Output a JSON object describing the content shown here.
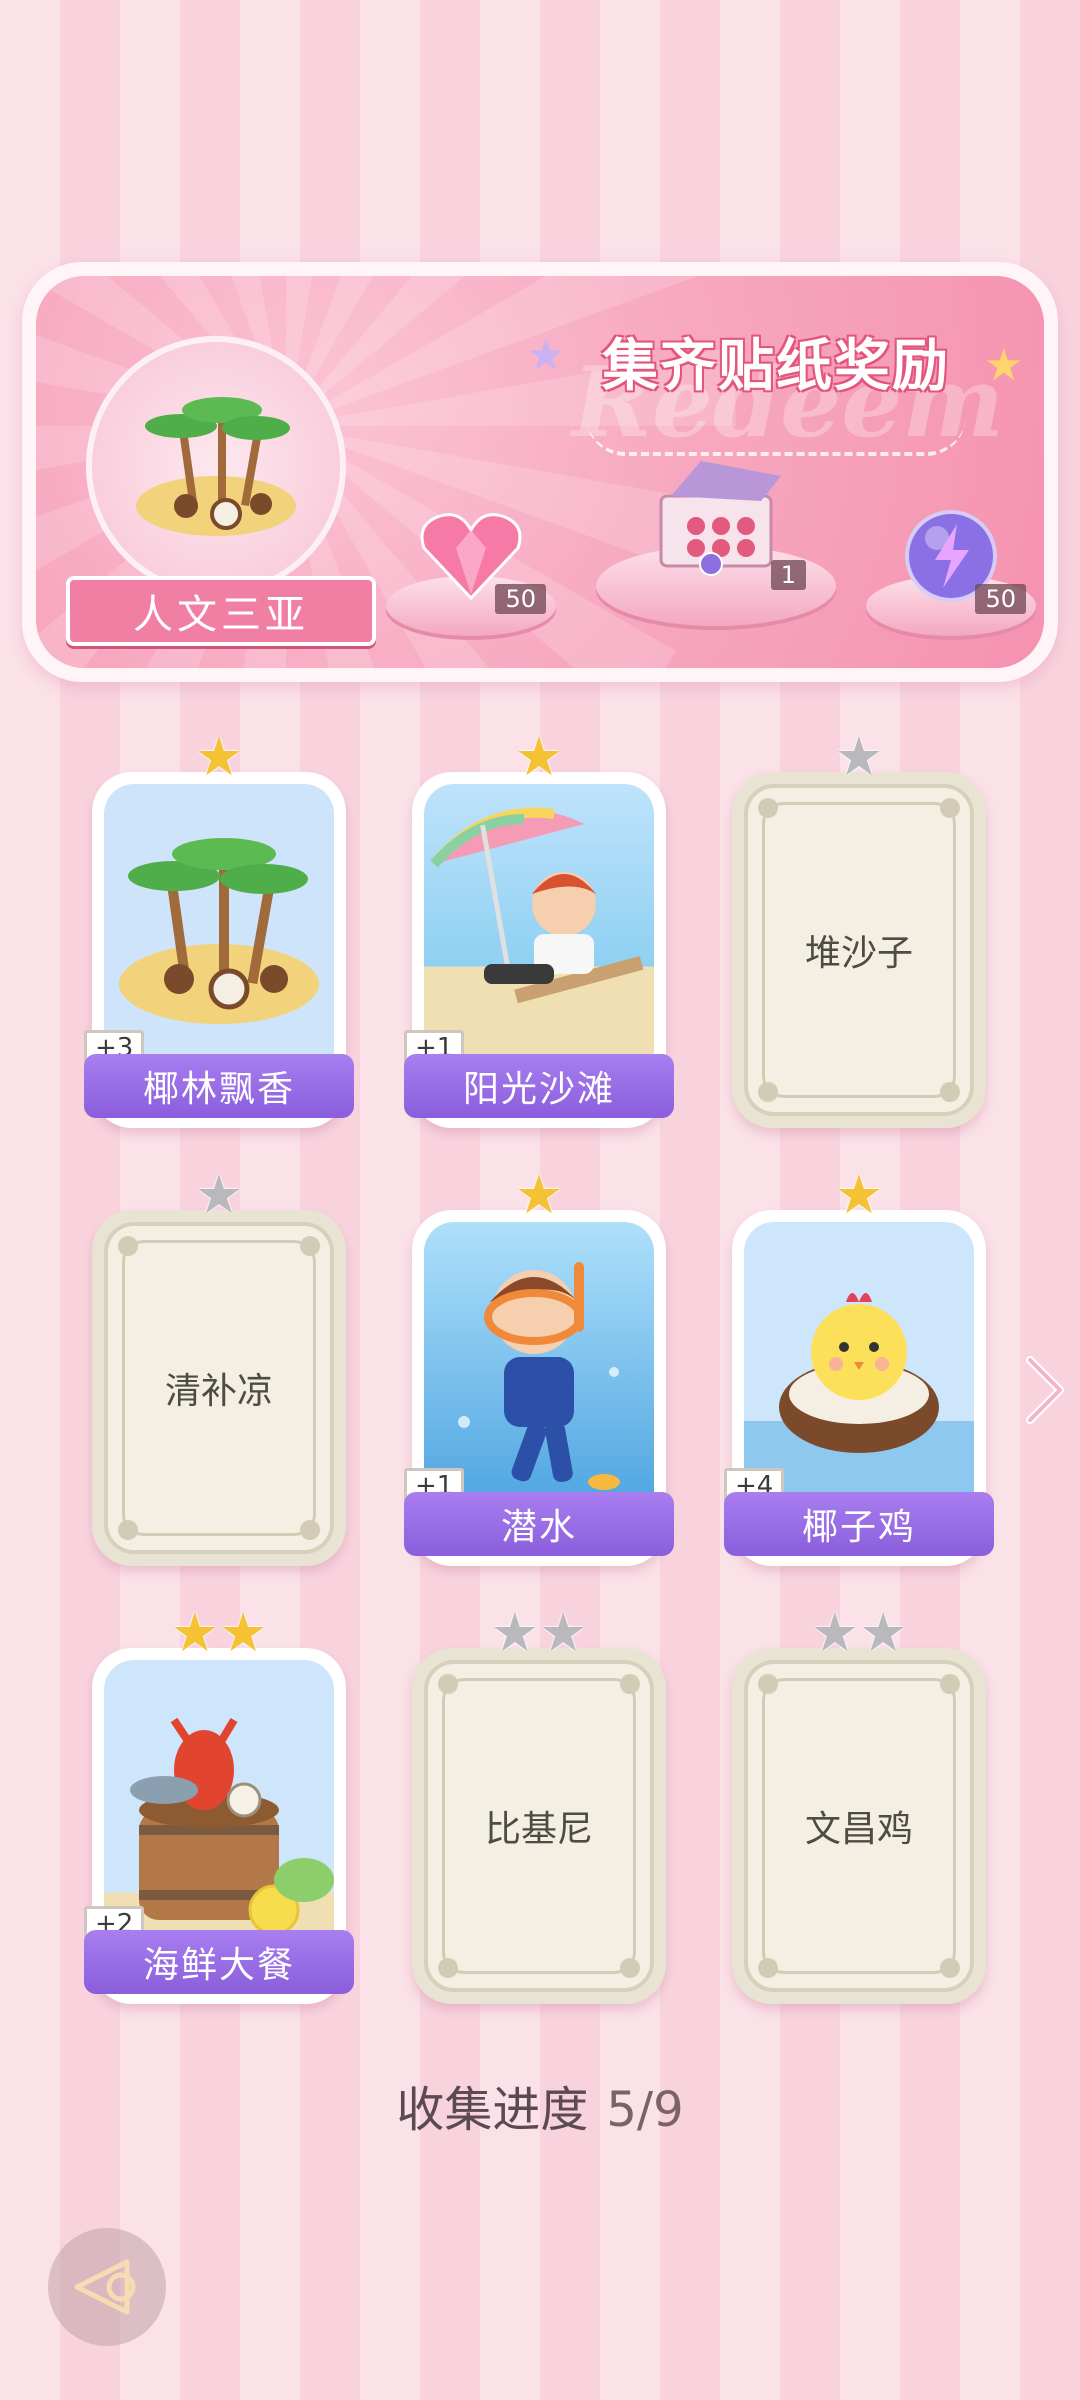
{
  "banner": {
    "title": "集齐贴纸奖励",
    "watermark": "Redeem",
    "region_name": "人文三亚",
    "rewards": [
      {
        "icon": "pink-heart-gem-icon",
        "count": "50"
      },
      {
        "icon": "gift-box-icon",
        "count": "1"
      },
      {
        "icon": "lightning-orb-icon",
        "count": "50"
      }
    ]
  },
  "cards": [
    {
      "name": "椰林飘香",
      "collected": true,
      "stars": 1,
      "plus": "+3",
      "image": "coconut-island-illustration"
    },
    {
      "name": "阳光沙滩",
      "collected": true,
      "stars": 1,
      "plus": "+1",
      "image": "beach-boy-illustration"
    },
    {
      "name": "堆沙子",
      "collected": false,
      "stars": 1,
      "plus": "",
      "image": ""
    },
    {
      "name": "清补凉",
      "collected": false,
      "stars": 1,
      "plus": "",
      "image": ""
    },
    {
      "name": "潜水",
      "collected": true,
      "stars": 1,
      "plus": "+1",
      "image": "diver-girl-illustration"
    },
    {
      "name": "椰子鸡",
      "collected": true,
      "stars": 1,
      "plus": "+4",
      "image": "coconut-chick-illustration"
    },
    {
      "name": "海鲜大餐",
      "collected": true,
      "stars": 2,
      "plus": "+2",
      "image": "seafood-barrel-illustration"
    },
    {
      "name": "比基尼",
      "collected": false,
      "stars": 2,
      "plus": "",
      "image": ""
    },
    {
      "name": "文昌鸡",
      "collected": false,
      "stars": 2,
      "plus": "",
      "image": ""
    }
  ],
  "progress": {
    "label": "收集进度",
    "value": "5/9"
  },
  "colors": {
    "accent_purple": "#9a6ee6",
    "banner_pink": "#f7a9c0",
    "star_gold": "#f5c234",
    "star_grey": "#b9b9bd"
  }
}
